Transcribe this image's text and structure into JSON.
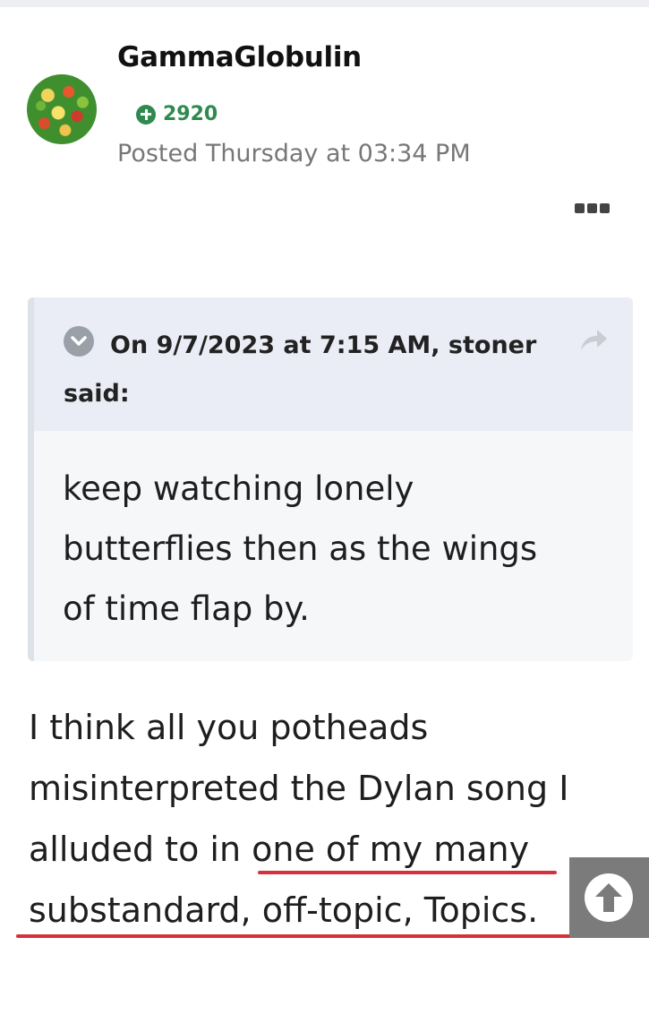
{
  "post": {
    "author": "GammaGlobulin",
    "reputation": "2920",
    "posted": "Posted Thursday at 03:34 PM",
    "avatar_icon": "avatar-image",
    "more_icon": "ellipsis-icon"
  },
  "quote": {
    "citation": "On 9/7/2023 at 7:15 AM, stoner said:",
    "lines": [
      "keep watching lonely",
      "butterflies then as the wings",
      "of time flap by."
    ]
  },
  "body": {
    "lines": [
      "I think all you potheads",
      "misinterpreted the Dylan song I",
      "alluded to in one of my many",
      "substandard, off-topic, Topics."
    ],
    "annotation_color": "#d6313b"
  },
  "scroll_top_icon": "arrow-up-circle-icon"
}
